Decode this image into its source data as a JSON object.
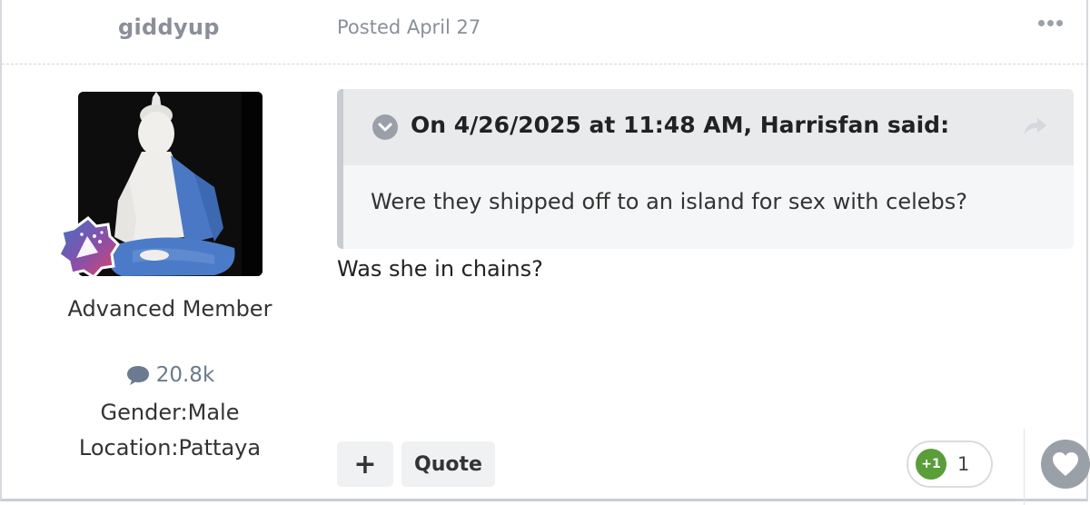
{
  "post": {
    "author": "giddyup",
    "date": "Posted April 27",
    "author_panel": {
      "rank": "Advanced Member",
      "post_count": "20.8k",
      "gender": "Gender:Male",
      "location": "Location:Pattaya"
    },
    "quote": {
      "header": "On 4/26/2025 at 11:48 AM, Harrisfan said:",
      "text": "Were they shipped off to an island for sex with celebs?"
    },
    "reply": "Was she in chains?",
    "actions": {
      "plus_label": "+",
      "quote_label": "Quote",
      "reaction_badge": "+1",
      "reaction_count": "1"
    }
  },
  "icons": {
    "more": "ellipsis-icon",
    "quote_toggle": "chevron-down-icon",
    "share": "share-arrow-icon",
    "comment": "comment-bubble-icon",
    "badge": "rank-badge-icon",
    "heart": "heart-icon"
  },
  "colors": {
    "muted": "#8a8f99",
    "reaction_green": "#5a9e3a",
    "quote_bg": "#f5f6f7",
    "quote_header_bg": "#e9eaec"
  }
}
